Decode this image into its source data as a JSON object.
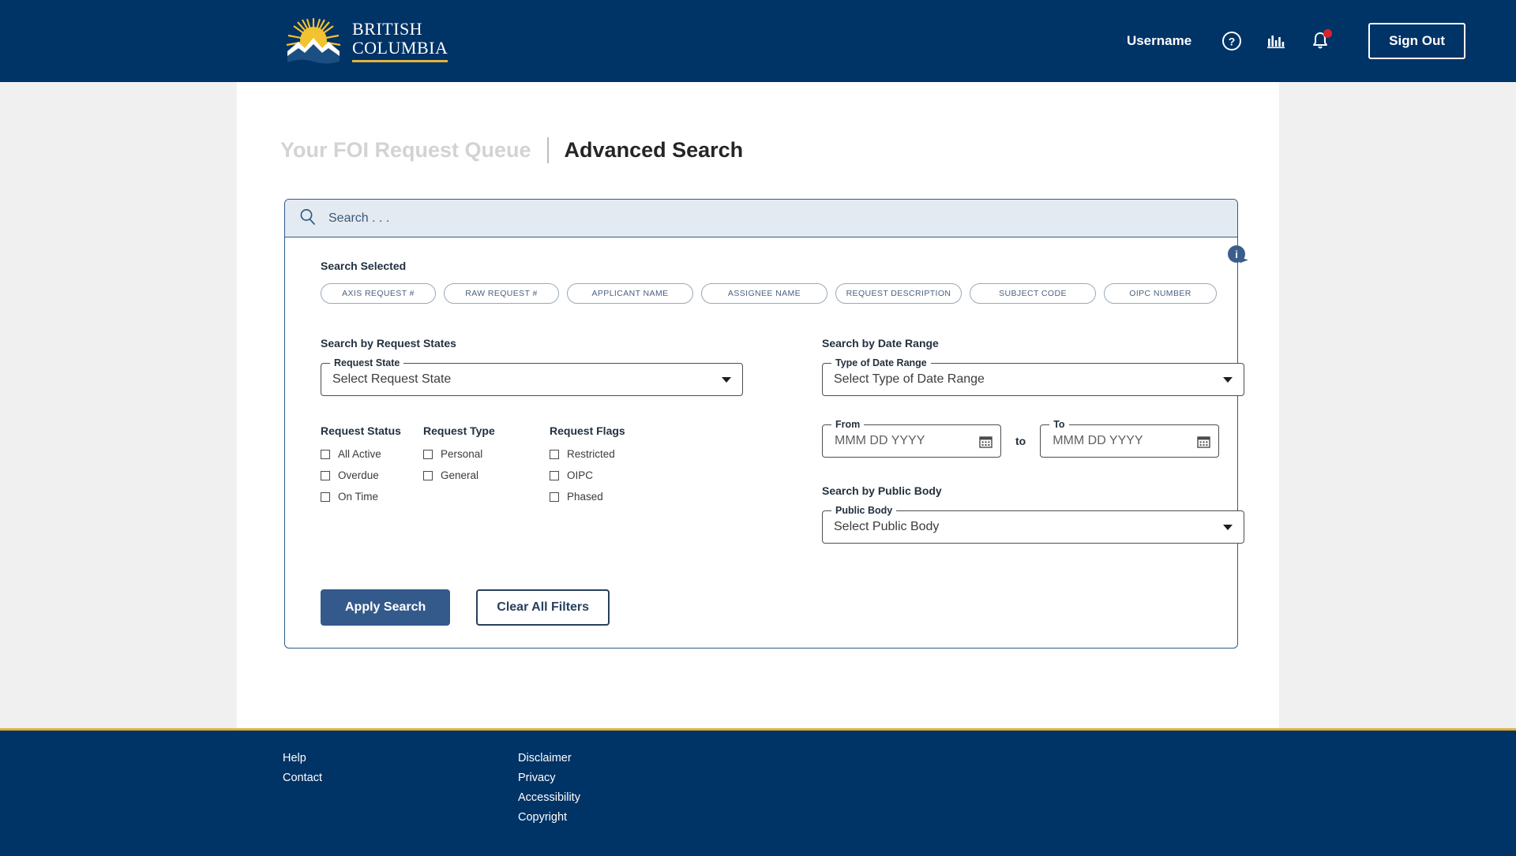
{
  "header": {
    "logo": {
      "line1": "BRITISH",
      "line2": "COLUMBIA",
      "icon": "bc-sun-mountain-logo"
    },
    "username": "Username",
    "help_icon": "question-circle-icon",
    "reports_icon": "bar-chart-icon",
    "notifications_icon": "bell-icon",
    "sign_out_label": "Sign Out"
  },
  "breadcrumb": {
    "previous": "Your FOI Request Queue",
    "current": "Advanced Search"
  },
  "search": {
    "placeholder": "Search . . .",
    "value": "",
    "icon": "search-icon",
    "selected_label": "Search Selected",
    "chips": [
      {
        "label": "AXIS REQUEST #",
        "width": "w1"
      },
      {
        "label": "RAW REQUEST #",
        "width": "w1"
      },
      {
        "label": "APPLICANT NAME",
        "width": "w2"
      },
      {
        "label": "ASSIGNEE NAME",
        "width": "w2"
      },
      {
        "label": "REQUEST DESCRIPTION",
        "width": "w2"
      },
      {
        "label": "SUBJECT CODE",
        "width": "w2"
      },
      {
        "label": "OIPC NUMBER",
        "width": "w3"
      }
    ],
    "info_badge": "i"
  },
  "request_states": {
    "section_title": "Search by Request States",
    "request_state": {
      "label": "Request State",
      "value": "Select Request State"
    },
    "status": {
      "title": "Request Status",
      "options": [
        "All Active",
        "Overdue",
        "On Time"
      ]
    },
    "type": {
      "title": "Request Type",
      "options": [
        "Personal",
        "General"
      ]
    },
    "flags": {
      "title": "Request Flags",
      "options": [
        "Restricted",
        "OIPC",
        "Phased"
      ]
    }
  },
  "date_range": {
    "section_title": "Search by Date Range",
    "type_of_date_range": {
      "label": "Type of Date Range",
      "value": "Select Type of Date Range"
    },
    "from": {
      "label": "From",
      "placeholder": "MMM DD YYYY",
      "value": ""
    },
    "separator": "to",
    "to": {
      "label": "To",
      "placeholder": "MMM DD YYYY",
      "value": ""
    },
    "calendar_icon": "calendar-icon"
  },
  "public_body": {
    "section_title": "Search by Public Body",
    "field": {
      "label": "Public Body",
      "value": "Select Public Body"
    }
  },
  "actions": {
    "apply": "Apply Search",
    "clear": "Clear All Filters"
  },
  "footer": {
    "column1": [
      "Help",
      "Contact"
    ],
    "column2": [
      "Disclaimer",
      "Privacy",
      "Accessibility",
      "Copyright"
    ]
  },
  "colors": {
    "brand_navy": "#003366",
    "brand_gold": "#e2b33c",
    "accent_blue": "#345a8c",
    "panel_border": "#2e5c8a",
    "searchbar_bg": "#e4eaf1",
    "notification_red": "#d8232a"
  }
}
